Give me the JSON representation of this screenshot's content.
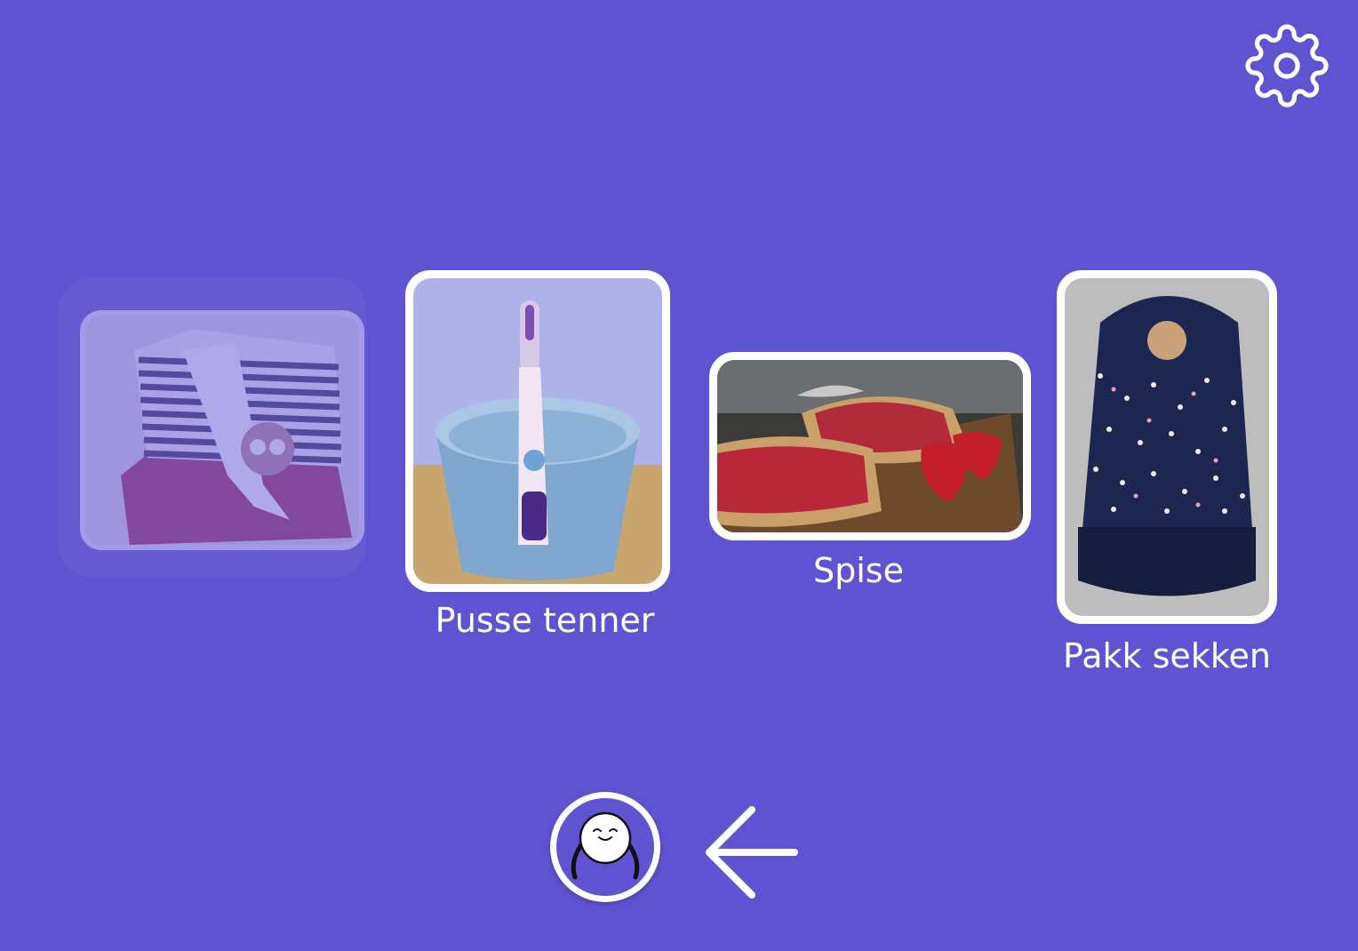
{
  "header": {
    "settings_icon": "gear-icon"
  },
  "activities": [
    {
      "label": "",
      "image": "clothes-photo",
      "state": "done"
    },
    {
      "label": "Pusse tenner",
      "image": "toothbrush-photo",
      "state": "active"
    },
    {
      "label": "Spise",
      "image": "jam-toast-photo",
      "state": "upcoming"
    },
    {
      "label": "Pakk sekken",
      "image": "backpack-photo",
      "state": "upcoming"
    }
  ],
  "footer": {
    "mascot_icon": "mascot-icon",
    "back_icon": "arrow-left-icon"
  },
  "colors": {
    "background": "#6053D1",
    "card_border": "#FFFFFF",
    "done_border": "#A39BE8",
    "text": "#FFFFFF"
  }
}
